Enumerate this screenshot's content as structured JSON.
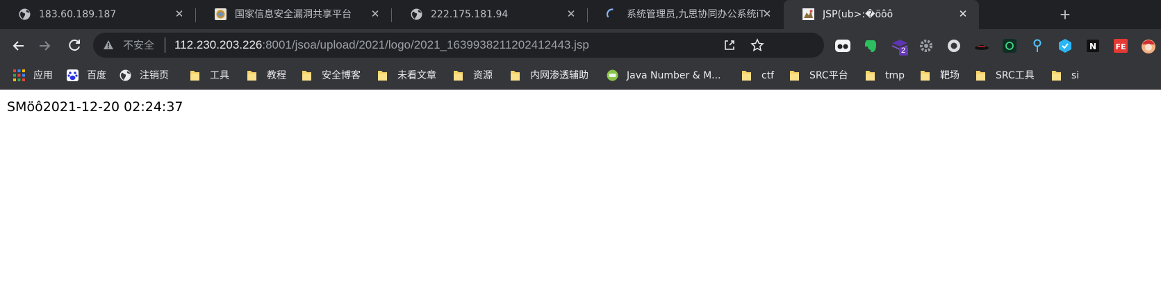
{
  "tabs": [
    {
      "title": "183.60.189.187",
      "icon": "globe-icon",
      "active": false
    },
    {
      "title": "国家信息安全漏洞共享平台",
      "icon": "cnvd-logo-icon",
      "active": false
    },
    {
      "title": "222.175.181.94",
      "icon": "globe-icon",
      "active": false
    },
    {
      "title": "系统管理员,九思协同办公系统iTh",
      "icon": "loading-spinner-icon",
      "active": false
    },
    {
      "title": "JSP(ub>:�öôô",
      "icon": "page-favicon-icon",
      "active": true
    }
  ],
  "close_glyph": "✕",
  "new_tab_glyph": "+",
  "toolbar": {
    "back": "←",
    "forward": "→",
    "reload": "⟳",
    "security_label": "不安全",
    "url_host": "112.230.203.226",
    "url_rest": ":8001/jsoa/upload/2021/logo/2021_1639938211202412443.jsp",
    "extension_badge": "2"
  },
  "bookmarks": [
    {
      "label": "应用",
      "icon": "apps-grid-icon"
    },
    {
      "label": "百度",
      "icon": "baidu-paw-icon"
    },
    {
      "label": "注销页",
      "icon": "globe-icon"
    },
    {
      "label": "工具",
      "icon": "folder-icon"
    },
    {
      "label": "教程",
      "icon": "folder-icon"
    },
    {
      "label": "安全博客",
      "icon": "folder-icon"
    },
    {
      "label": "未看文章",
      "icon": "folder-icon"
    },
    {
      "label": "资源",
      "icon": "folder-icon"
    },
    {
      "label": "内网渗透辅助",
      "icon": "folder-icon"
    },
    {
      "label": "Java Number & M...",
      "icon": "site-favicon-icon"
    },
    {
      "label": "ctf",
      "icon": "folder-icon"
    },
    {
      "label": "SRC平台",
      "icon": "folder-icon"
    },
    {
      "label": "tmp",
      "icon": "folder-icon"
    },
    {
      "label": "靶场",
      "icon": "folder-icon"
    },
    {
      "label": "SRC工具",
      "icon": "folder-icon"
    },
    {
      "label": "si",
      "icon": "folder-icon"
    }
  ],
  "page": {
    "text": "SMöô2021-12-20 02:24:37"
  },
  "colors": {
    "tabstrip": "#202124",
    "toolbar": "#35363a",
    "omnibox": "#202124",
    "folder": "#f6d365"
  }
}
